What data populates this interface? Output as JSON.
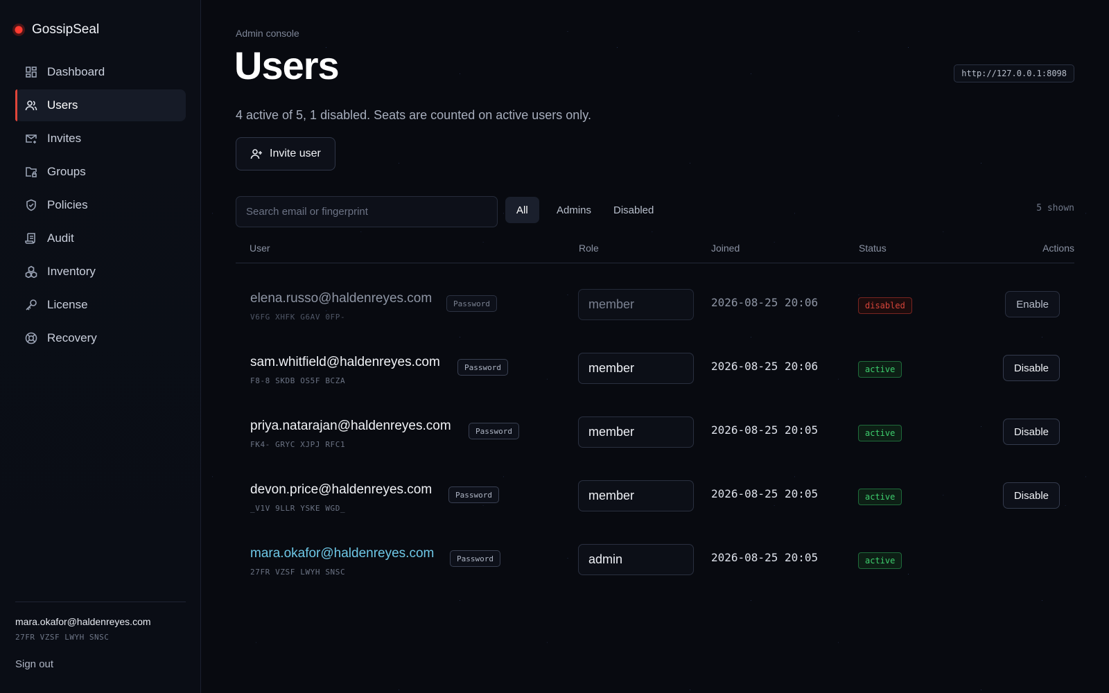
{
  "app": {
    "name": "GossipSeal",
    "brand_color": "#ff3b30"
  },
  "sidebar": {
    "items": [
      {
        "label": "Dashboard",
        "icon": "dashboard-icon",
        "active": false
      },
      {
        "label": "Users",
        "icon": "users-icon",
        "active": true
      },
      {
        "label": "Invites",
        "icon": "mail-plus-icon",
        "active": false
      },
      {
        "label": "Groups",
        "icon": "folder-lock-icon",
        "active": false
      },
      {
        "label": "Policies",
        "icon": "shield-icon",
        "active": false
      },
      {
        "label": "Audit",
        "icon": "scroll-icon",
        "active": false
      },
      {
        "label": "Inventory",
        "icon": "boxes-icon",
        "active": false
      },
      {
        "label": "License",
        "icon": "key-icon",
        "active": false
      },
      {
        "label": "Recovery",
        "icon": "lifebuoy-icon",
        "active": false
      }
    ],
    "footer": {
      "email": "mara.okafor@haldenreyes.com",
      "fingerprint": "27FR VZSF LWYH SNSC",
      "signout_label": "Sign out"
    }
  },
  "header": {
    "eyebrow": "Admin console",
    "title": "Users",
    "url": "http://127.0.0.1:8098",
    "subtitle": "4 active of 5, 1 disabled. Seats are counted on active users only.",
    "invite_label": "Invite user"
  },
  "filters": {
    "search_placeholder": "Search email or fingerprint",
    "chips": [
      "All",
      "Admins",
      "Disabled"
    ],
    "active_chip": "All",
    "shown_count": "5 shown"
  },
  "table": {
    "columns": [
      "User",
      "Role",
      "Joined",
      "Status",
      "Actions"
    ],
    "rows": [
      {
        "email": "elena.russo@haldenreyes.com",
        "fingerprint": "V6FG XHFK G6AV 0FP-",
        "auth": "Password",
        "role": "member",
        "joined": "2026-08-25 20:06",
        "status": "disabled",
        "action": "Enable"
      },
      {
        "email": "sam.whitfield@haldenreyes.com",
        "fingerprint": "F8-8 SKDB OS5F BCZA",
        "auth": "Password",
        "role": "member",
        "joined": "2026-08-25 20:06",
        "status": "active",
        "action": "Disable"
      },
      {
        "email": "priya.natarajan@haldenreyes.com",
        "fingerprint": "FK4- GRYC XJPJ RFC1",
        "auth": "Password",
        "role": "member",
        "joined": "2026-08-25 20:05",
        "status": "active",
        "action": "Disable"
      },
      {
        "email": "devon.price@haldenreyes.com",
        "fingerprint": "_V1V 9LLR YSKE WGD_",
        "auth": "Password",
        "role": "member",
        "joined": "2026-08-25 20:05",
        "status": "active",
        "action": "Disable"
      },
      {
        "email": "mara.okafor@haldenreyes.com",
        "fingerprint": "27FR VZSF LWYH SNSC",
        "auth": "Password",
        "role": "admin",
        "joined": "2026-08-25 20:05",
        "status": "active",
        "action": ""
      }
    ]
  },
  "colors": {
    "active_accent": "#e0453a",
    "status_active": "#3ecf6e",
    "status_disabled": "#d6443a",
    "self_email": "#6ec7e6"
  }
}
